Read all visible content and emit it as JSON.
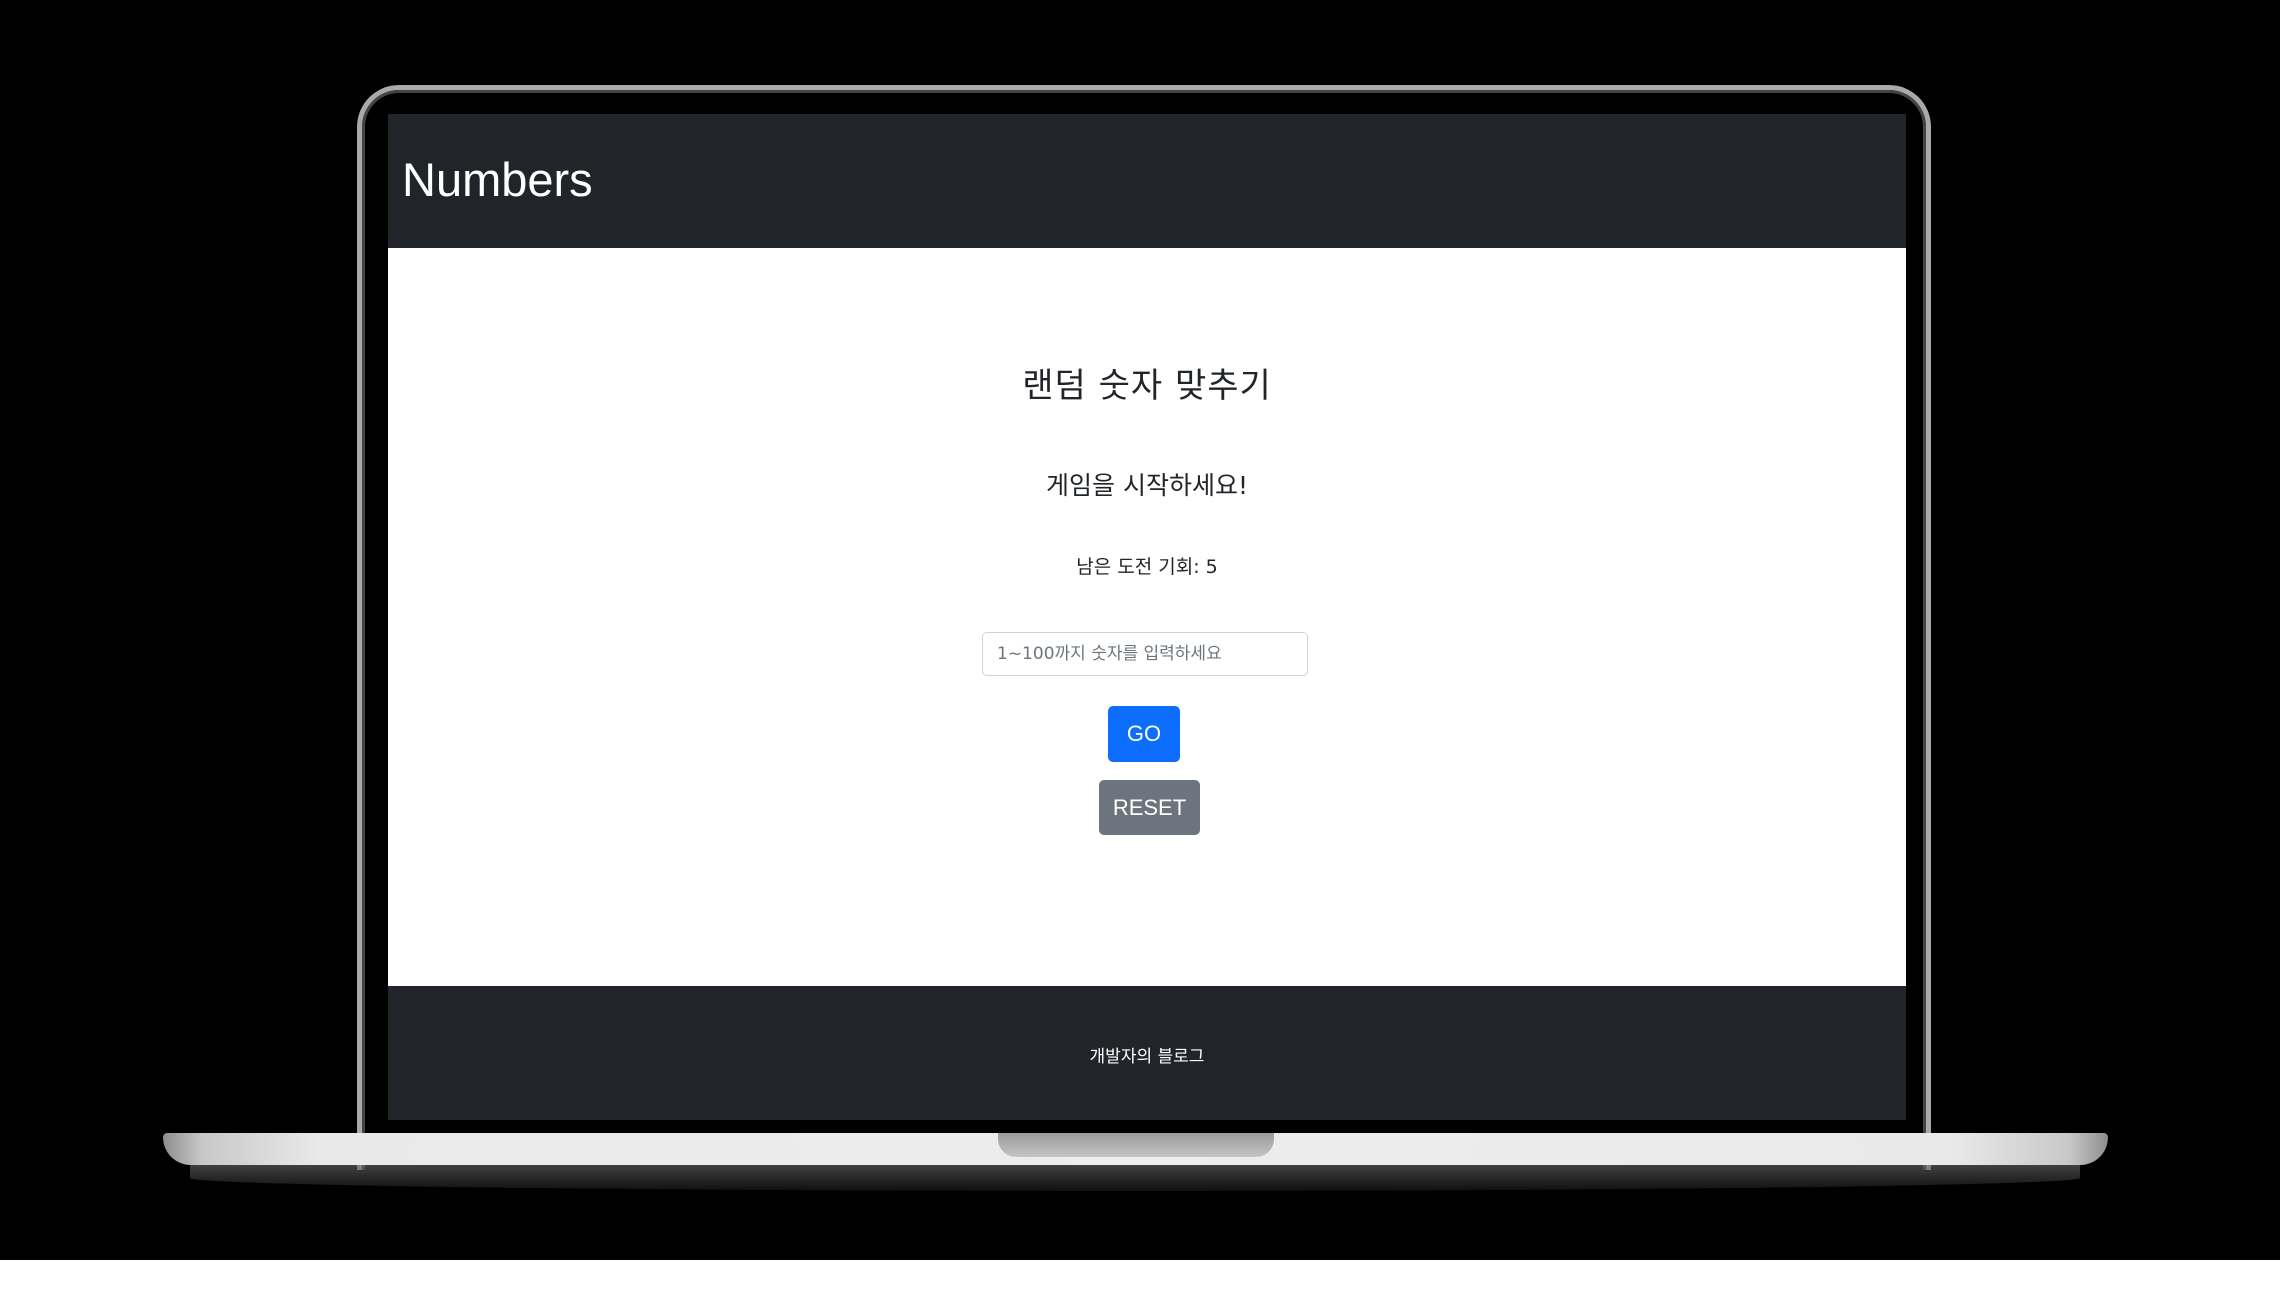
{
  "app": {
    "brand": "Numbers"
  },
  "game": {
    "title": "랜덤 숫자 맞추기",
    "message": "게임을 시작하세요!",
    "chances_label": "남은 도전 기회: 5"
  },
  "input": {
    "value": "",
    "placeholder": "1~100까지 숫자를 입력하세요"
  },
  "buttons": {
    "go_label": "GO",
    "reset_label": "RESET"
  },
  "footer": {
    "link_label": "개발자의 블로그"
  },
  "colors": {
    "navbar": "#212529",
    "primary": "#0d6efd",
    "secondary": "#6c757d"
  }
}
